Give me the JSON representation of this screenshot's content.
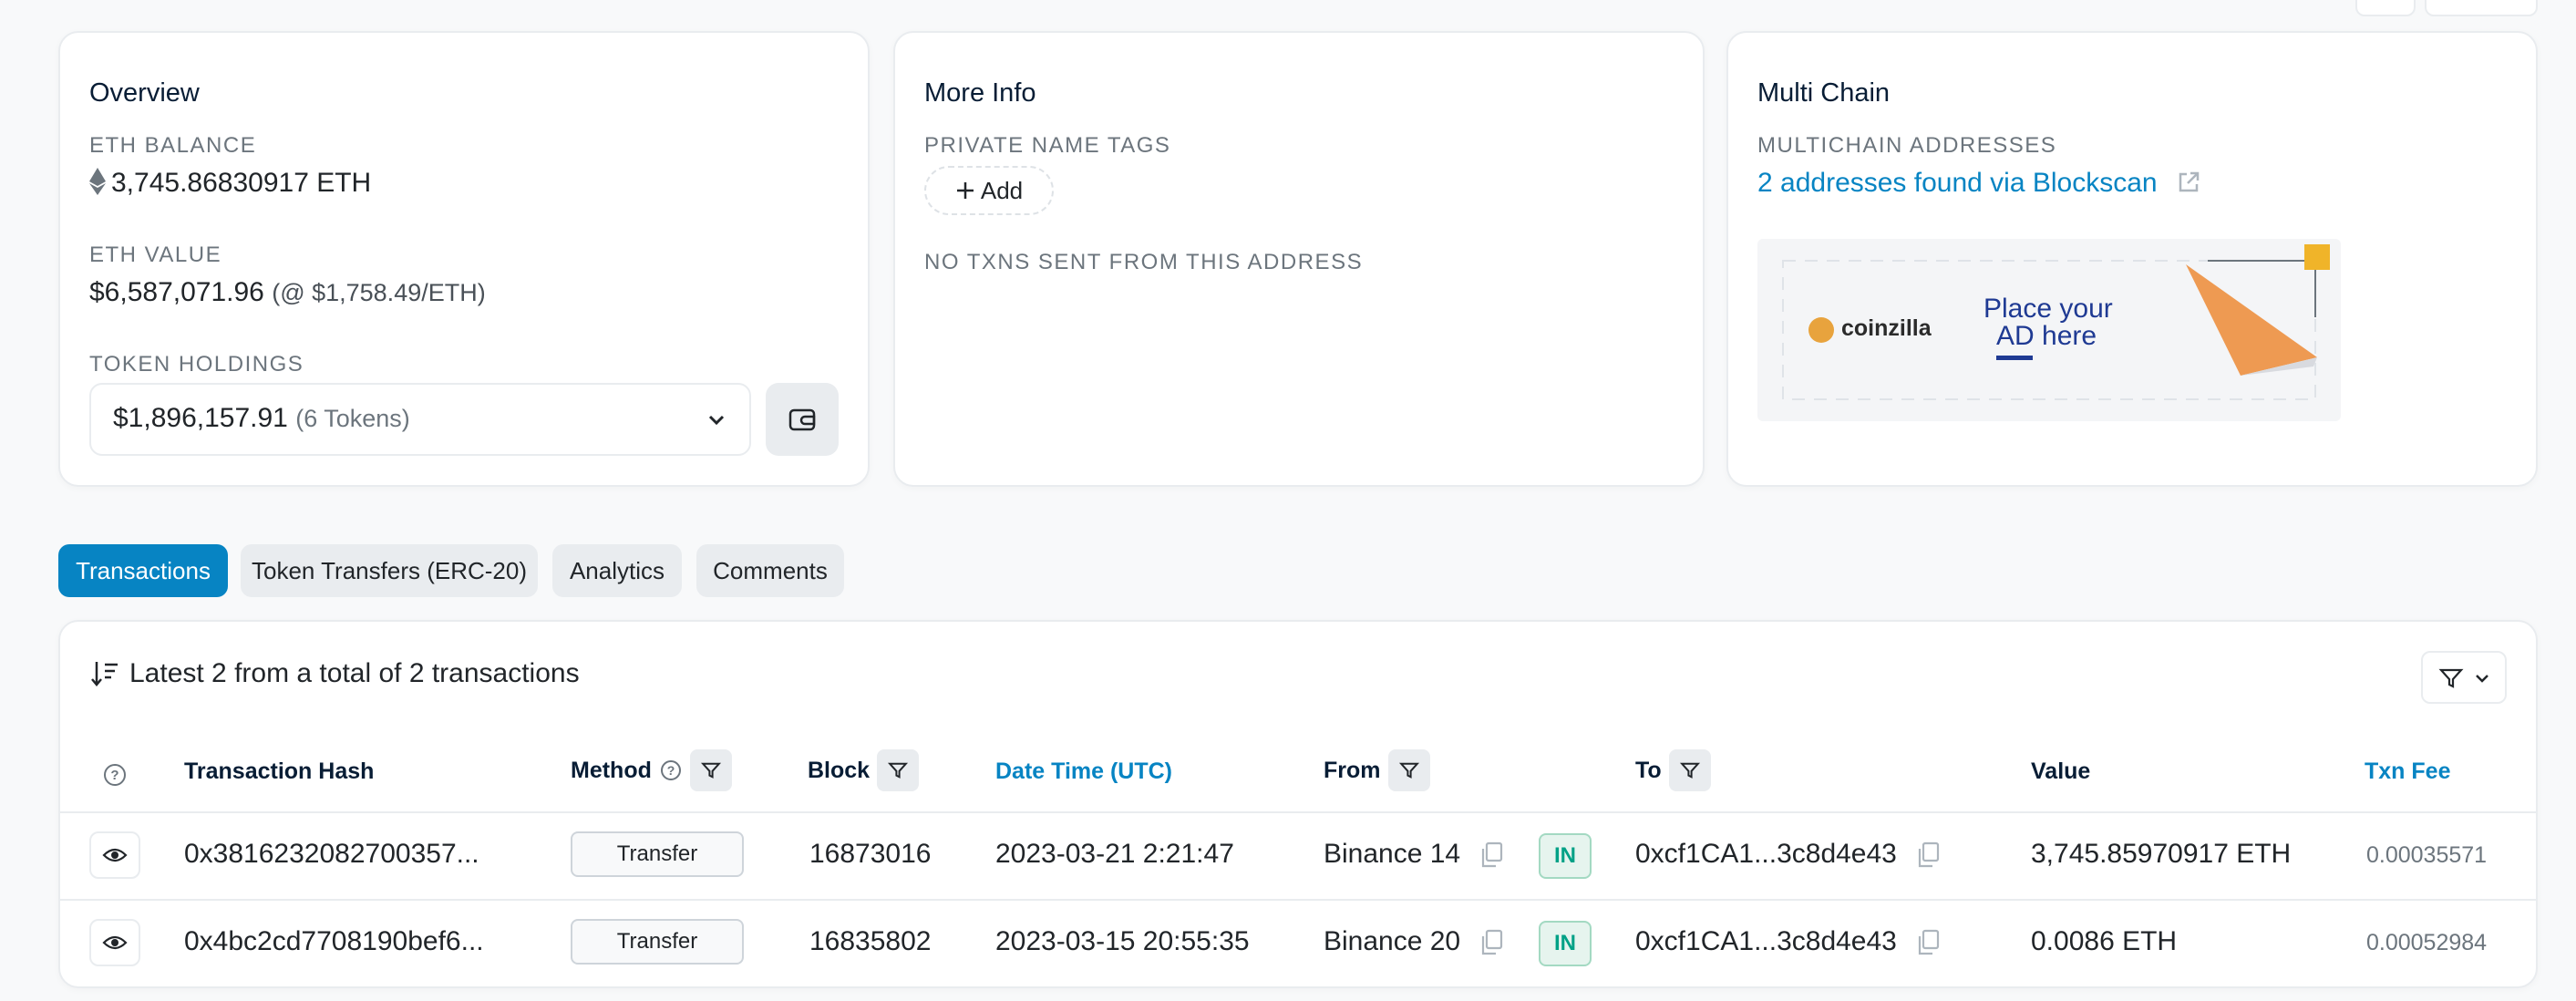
{
  "overview": {
    "title": "Overview",
    "eth_balance_label": "ETH BALANCE",
    "eth_balance": "3,745.86830917 ETH",
    "eth_value_label": "ETH VALUE",
    "eth_value": "$6,587,071.96",
    "eth_price": "(@ $1,758.49/ETH)",
    "token_holdings_label": "TOKEN HOLDINGS",
    "token_amount": "$1,896,157.91",
    "token_count": "(6 Tokens)"
  },
  "more_info": {
    "title": "More Info",
    "private_tags_label": "PRIVATE NAME TAGS",
    "add_label": "Add",
    "no_txns": "NO TXNS SENT FROM THIS ADDRESS"
  },
  "multi_chain": {
    "title": "Multi Chain",
    "addresses_label": "MULTICHAIN ADDRESSES",
    "addresses_link": "2 addresses found via Blockscan",
    "ad_brand": "coinzilla",
    "ad_text_1": "Place your",
    "ad_text_2": "AD here"
  },
  "tabs": [
    {
      "label": "Transactions",
      "active": true
    },
    {
      "label": "Token Transfers (ERC-20)",
      "active": false
    },
    {
      "label": "Analytics",
      "active": false
    },
    {
      "label": "Comments",
      "active": false
    }
  ],
  "transactions": {
    "summary": "Latest 2 from a total of 2 transactions",
    "columns": {
      "hash": "Transaction Hash",
      "method": "Method",
      "block": "Block",
      "datetime": "Date Time (UTC)",
      "from": "From",
      "to": "To",
      "value": "Value",
      "fee": "Txn Fee"
    },
    "rows": [
      {
        "hash": "0x3816232082700357...",
        "method": "Transfer",
        "block": "16873016",
        "datetime": "2023-03-21 2:21:47",
        "from": "Binance 14",
        "direction": "IN",
        "to": "0xcf1CA1...3c8d4e43",
        "value": "3,745.85970917 ETH",
        "fee": "0.00035571"
      },
      {
        "hash": "0x4bc2cd7708190bef6...",
        "method": "Transfer",
        "block": "16835802",
        "datetime": "2023-03-15 20:55:35",
        "from": "Binance 20",
        "direction": "IN",
        "to": "0xcf1CA1...3c8d4e43",
        "value": "0.0086 ETH",
        "fee": "0.00052984"
      }
    ]
  },
  "colors": {
    "accent": "#0784c3",
    "in_badge": "#00a186",
    "background": "#f8f9fa"
  }
}
